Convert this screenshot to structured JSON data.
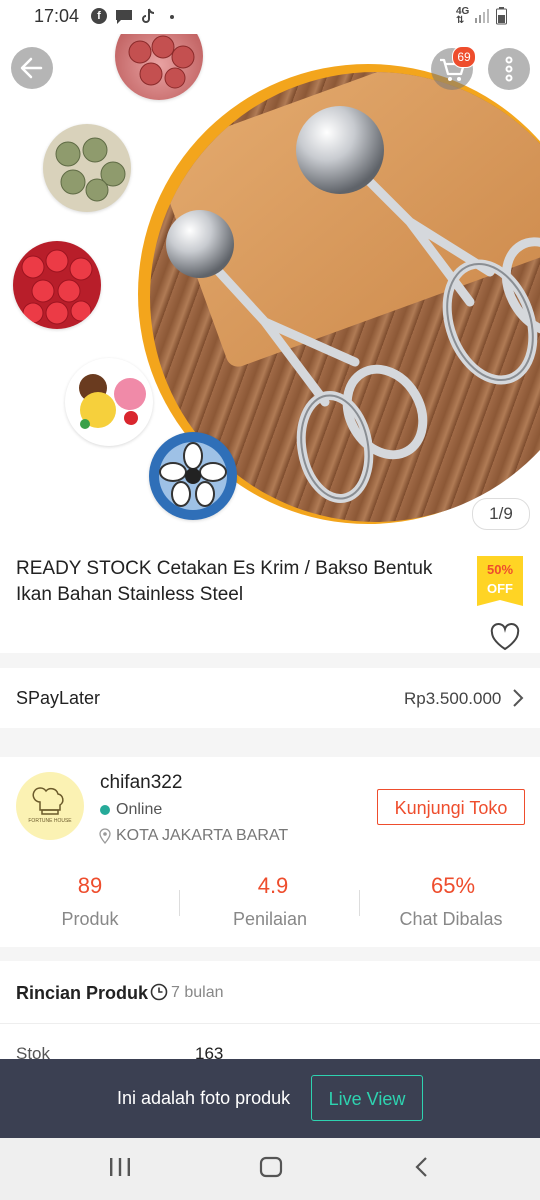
{
  "status_bar": {
    "time": "17:04",
    "network": "4G",
    "icons": [
      "facebook-icon",
      "message-icon",
      "tiktok-icon",
      "dot-icon",
      "signal-icon",
      "battery-icon"
    ]
  },
  "hero": {
    "cart_count": "69",
    "image_counter": "1/9",
    "thumbnails": [
      "meatballs-raw",
      "meatballs-cooked",
      "red-balls",
      "ice-cream-scoops",
      "flower-mold"
    ]
  },
  "product": {
    "title": "READY STOCK Cetakan Es Krim / Bakso Bentuk Ikan Bahan Stainless Steel",
    "discount_line1": "50%",
    "discount_line2": "OFF"
  },
  "paylater": {
    "label": "SPayLater",
    "amount": "Rp3.500.000"
  },
  "shop": {
    "name": "chifan322",
    "status": "Online",
    "location": "KOTA JAKARTA BARAT",
    "visit_button": "Kunjungi Toko",
    "avatar_caption": "FORTUNE HOUSE",
    "stats": [
      {
        "value": "89",
        "label": "Produk"
      },
      {
        "value": "4.9",
        "label": "Penilaian"
      },
      {
        "value": "65%",
        "label": "Chat Dibalas"
      }
    ]
  },
  "details": {
    "heading": "Rincian Produk",
    "age": "7 bulan",
    "stock_label": "Stok",
    "stock_value": "163"
  },
  "banner": {
    "text": "Ini adalah foto produk",
    "button": "Live View"
  },
  "colors": {
    "accent": "#ee4d2d",
    "teal": "#2ed3b0",
    "banner_bg": "#3b4052",
    "online": "#26aa99",
    "badge_yellow": "#ffd424"
  }
}
